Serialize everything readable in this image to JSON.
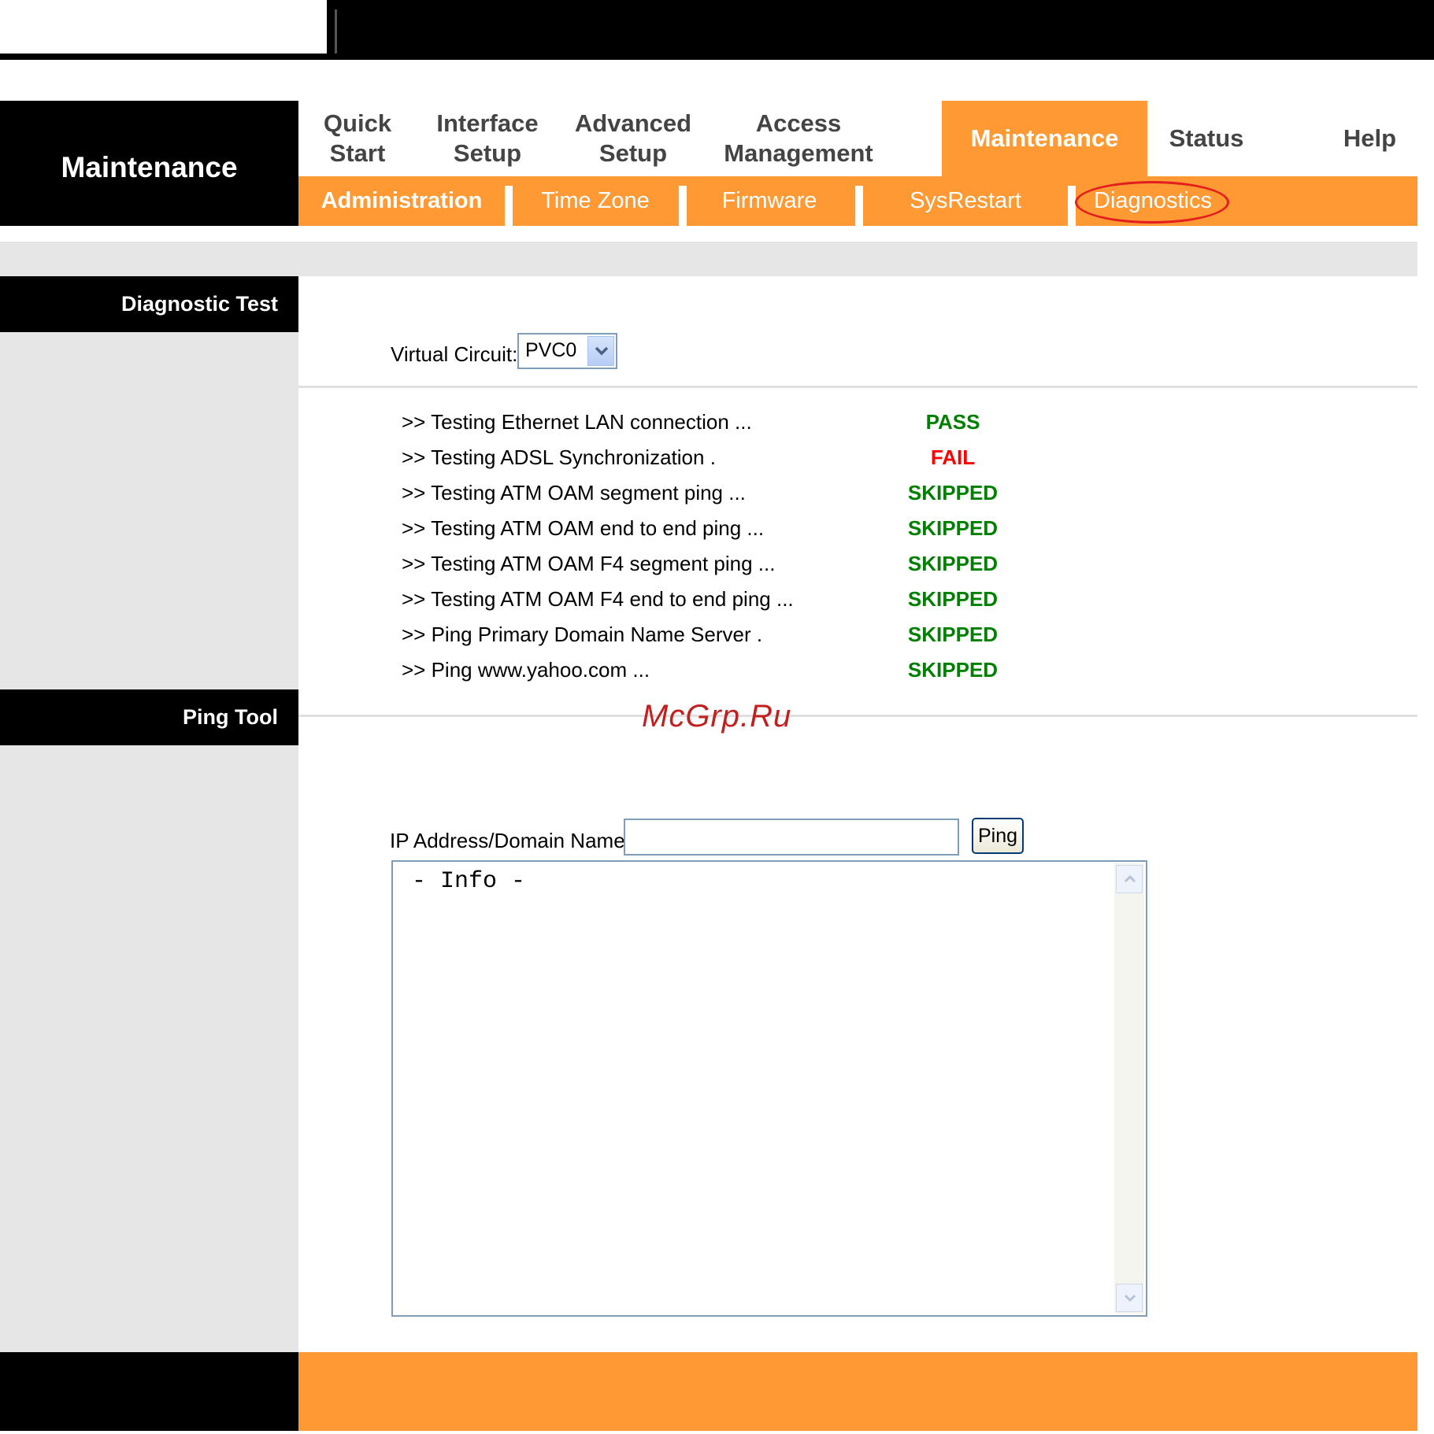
{
  "header": {
    "section_title": "Maintenance"
  },
  "main_nav": {
    "tabs": [
      {
        "label": "Quick\nStart",
        "active": false
      },
      {
        "label": "Interface\nSetup",
        "active": false
      },
      {
        "label": "Advanced\nSetup",
        "active": false
      },
      {
        "label": "Access\nManagement",
        "active": false
      },
      {
        "label": "Maintenance",
        "active": true
      },
      {
        "label": "Status",
        "active": false
      },
      {
        "label": "Help",
        "active": false
      }
    ]
  },
  "sub_nav": {
    "tabs": [
      {
        "label": "Administration",
        "active": true
      },
      {
        "label": "Time Zone",
        "active": false
      },
      {
        "label": "Firmware",
        "active": false
      },
      {
        "label": "SysRestart",
        "active": false
      },
      {
        "label": "Diagnostics",
        "active": false,
        "highlighted": true
      }
    ],
    "highlight_color": "#e41e1e"
  },
  "diagnostic_test": {
    "section_label": "Diagnostic Test",
    "virtual_circuit_label": "Virtual Circuit:",
    "virtual_circuit_value": "PVC0",
    "tests": [
      {
        "label": ">> Testing Ethernet LAN connection ...",
        "result": "PASS",
        "result_color": "#008000"
      },
      {
        "label": ">> Testing ADSL Synchronization .",
        "result": "FAIL",
        "result_color": "#ff0000"
      },
      {
        "label": ">> Testing ATM OAM segment ping ...",
        "result": "SKIPPED",
        "result_color": "#008000"
      },
      {
        "label": ">> Testing ATM OAM end to end ping ...",
        "result": "SKIPPED",
        "result_color": "#008000"
      },
      {
        "label": ">> Testing ATM OAM F4 segment ping ...",
        "result": "SKIPPED",
        "result_color": "#008000"
      },
      {
        "label": ">> Testing ATM OAM F4 end to end ping ...",
        "result": "SKIPPED",
        "result_color": "#008000"
      },
      {
        "label": ">> Ping Primary Domain Name Server .",
        "result": "SKIPPED",
        "result_color": "#008000"
      },
      {
        "label": ">> Ping www.yahoo.com ...",
        "result": "SKIPPED",
        "result_color": "#008000"
      }
    ]
  },
  "ping_tool": {
    "section_label": "Ping Tool",
    "ip_label": "IP Address/Domain Name:",
    "ip_value": "",
    "ping_button": "Ping",
    "info_text": "- Info -"
  },
  "watermark": "McGrp.Ru",
  "colors": {
    "accent_orange": "#ff9933",
    "black": "#000000",
    "grey_panel": "#e6e6e6"
  }
}
